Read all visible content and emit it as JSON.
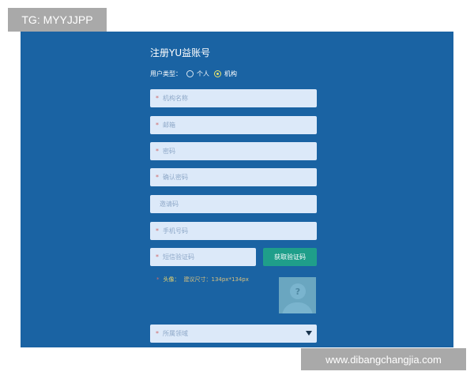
{
  "overlays": {
    "top_left_label": "TG: MYYJJPP",
    "bottom_right_label": "www.dibangchangjia.com"
  },
  "form": {
    "title": "注册YU益账号",
    "user_type_label": "用户类型：",
    "user_types": [
      "个人",
      "机构"
    ],
    "selected_user_type": "机构",
    "fields": {
      "org_name": "机构名称",
      "email": "邮箱",
      "password": "密码",
      "confirm_password": "确认密码",
      "invite_code": "邀请码",
      "phone": "手机号码",
      "sms_code": "短信验证码",
      "region": "所属领域"
    },
    "required_mark": "*",
    "get_code_button": "获取验证码",
    "avatar_label": "头像：",
    "avatar_hint": "建议尺寸：134px*134px",
    "avatar_placeholder_symbol": "?"
  },
  "colors": {
    "panel_bg": "#1a63a3",
    "field_bg": "#dce9f9",
    "button_bg": "#1f9e8a",
    "accent_yellow": "#e9e56b"
  }
}
